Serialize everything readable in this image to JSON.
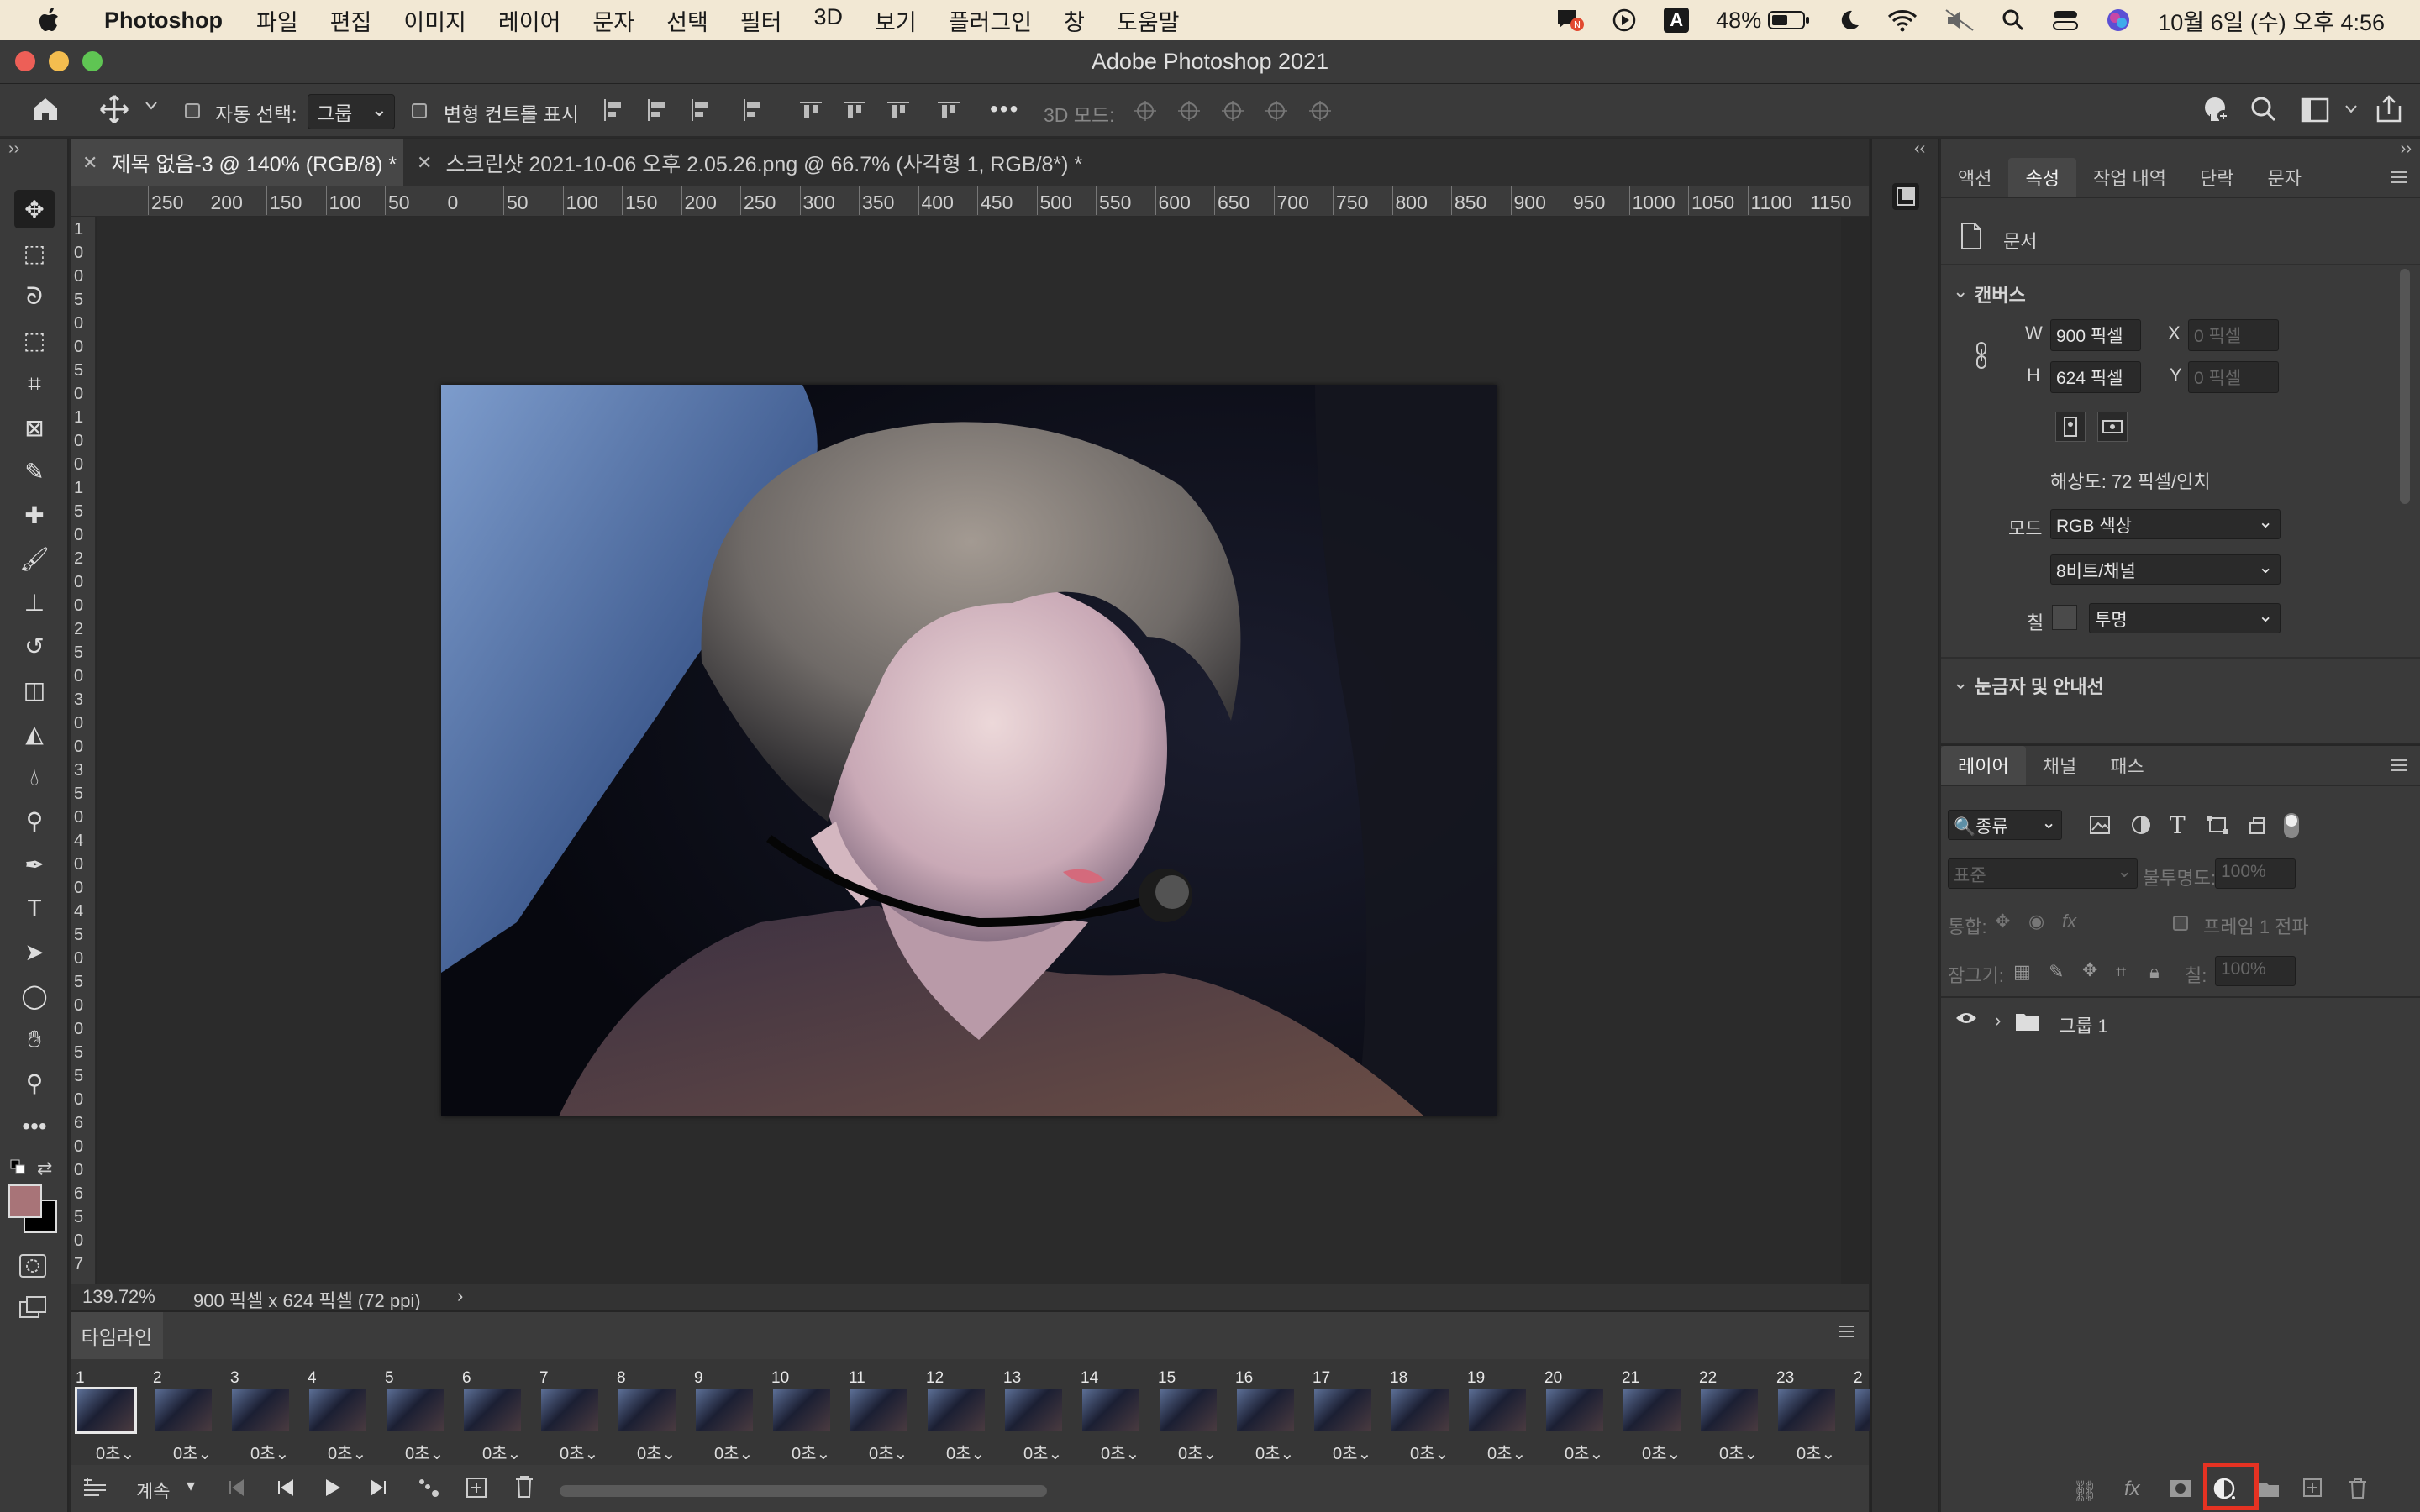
{
  "menubar": {
    "app_name": "Photoshop",
    "menus": [
      "파일",
      "편집",
      "이미지",
      "레이어",
      "문자",
      "선택",
      "필터",
      "3D",
      "보기",
      "플러그인",
      "창",
      "도움말"
    ],
    "battery": "48%",
    "input_indicator": "A",
    "clock": "10월 6일 (수) 오후 4:56"
  },
  "window": {
    "title": "Adobe Photoshop 2021"
  },
  "options_bar": {
    "auto_select_label": "자동 선택:",
    "auto_select_value": "그룹",
    "transform_controls_label": "변형 컨트롤 표시",
    "mode_3d_label": "3D 모드:",
    "more": "•••"
  },
  "doc_tabs": [
    {
      "title": "제목 없음-3 @ 140% (RGB/8) *",
      "active": true
    },
    {
      "title": "스크린샷 2021-10-06 오후 2.05.26.png @ 66.7% (사각형 1, RGB/8*) *",
      "active": false
    }
  ],
  "ruler": {
    "horizontal": [
      "250",
      "200",
      "150",
      "100",
      "50",
      "0",
      "50",
      "100",
      "150",
      "200",
      "250",
      "300",
      "350",
      "400",
      "450",
      "500",
      "550",
      "600",
      "650",
      "700",
      "750",
      "800",
      "850",
      "900",
      "950",
      "1000",
      "1050",
      "1100",
      "1150"
    ],
    "vertical": [
      "1",
      "0",
      "0",
      "5",
      "0",
      "0",
      "5",
      "0",
      "1",
      "0",
      "0",
      "1",
      "5",
      "0",
      "2",
      "0",
      "0",
      "2",
      "5",
      "0",
      "3",
      "0",
      "0",
      "3",
      "5",
      "0",
      "4",
      "0",
      "0",
      "4",
      "5",
      "0",
      "5",
      "0",
      "0",
      "5",
      "5",
      "0",
      "6",
      "0",
      "0",
      "6",
      "5",
      "0",
      "7"
    ]
  },
  "status": {
    "zoom": "139.72%",
    "doc_info": "900 픽셀 x 624 픽셀 (72 ppi)",
    "arrow": "›"
  },
  "timeline": {
    "title": "타임라인",
    "frames": [
      {
        "n": "1",
        "d": "0초"
      },
      {
        "n": "2",
        "d": "0초"
      },
      {
        "n": "3",
        "d": "0초"
      },
      {
        "n": "4",
        "d": "0초"
      },
      {
        "n": "5",
        "d": "0초"
      },
      {
        "n": "6",
        "d": "0초"
      },
      {
        "n": "7",
        "d": "0초"
      },
      {
        "n": "8",
        "d": "0초"
      },
      {
        "n": "9",
        "d": "0초"
      },
      {
        "n": "10",
        "d": "0초"
      },
      {
        "n": "11",
        "d": "0초"
      },
      {
        "n": "12",
        "d": "0초"
      },
      {
        "n": "13",
        "d": "0초"
      },
      {
        "n": "14",
        "d": "0초"
      },
      {
        "n": "15",
        "d": "0초"
      },
      {
        "n": "16",
        "d": "0초"
      },
      {
        "n": "17",
        "d": "0초"
      },
      {
        "n": "18",
        "d": "0초"
      },
      {
        "n": "19",
        "d": "0초"
      },
      {
        "n": "20",
        "d": "0초"
      },
      {
        "n": "21",
        "d": "0초"
      },
      {
        "n": "22",
        "d": "0초"
      },
      {
        "n": "23",
        "d": "0초"
      },
      {
        "n": "2",
        "d": ""
      }
    ],
    "loop_label": "계속"
  },
  "properties": {
    "tabs": [
      "액션",
      "속성",
      "작업 내역",
      "단락",
      "문자"
    ],
    "active_tab": "속성",
    "doc_label": "문서",
    "canvas_section": "캔버스",
    "w_label": "W",
    "w_value": "900 픽셀",
    "h_label": "H",
    "h_value": "624 픽셀",
    "x_label": "X",
    "x_placeholder": "0 픽셀",
    "y_label": "Y",
    "y_placeholder": "0 픽셀",
    "resolution": "해상도: 72 픽셀/인치",
    "mode_label": "모드",
    "mode_value": "RGB 색상",
    "depth_value": "8비트/채널",
    "fill_label": "칠",
    "fill_value": "투명",
    "rulers_section": "눈금자 및 안내선"
  },
  "layers": {
    "tabs": [
      "레이어",
      "채널",
      "패스"
    ],
    "active_tab": "레이어",
    "filter_label": "종류",
    "blend_mode": "표준",
    "opacity_label": "불투명도:",
    "opacity_value": "100%",
    "unify_label": "통합:",
    "propagate_label": "프레임 1 전파",
    "lock_label": "잠그기:",
    "fill_label": "칠:",
    "fill_value": "100%",
    "items": [
      {
        "name": "그룹 1",
        "type": "group",
        "visible": true
      }
    ]
  },
  "colors": {
    "foreground": "#a87478",
    "background": "#000000",
    "highlight": "#e53222"
  }
}
